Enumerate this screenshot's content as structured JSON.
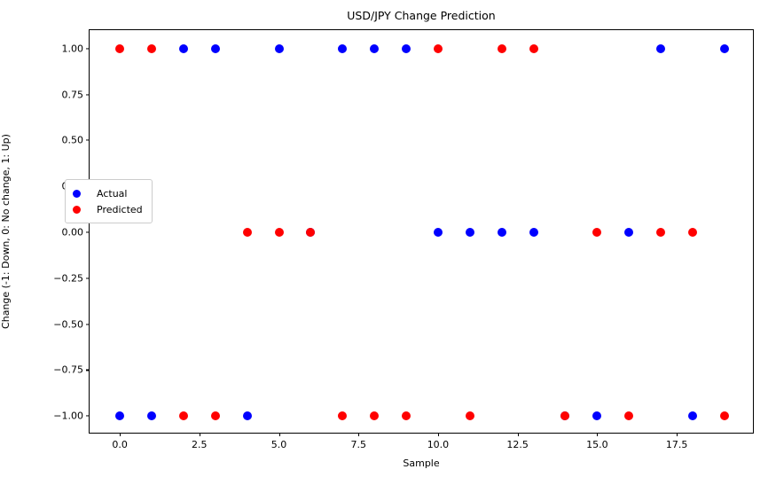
{
  "chart_data": {
    "type": "scatter",
    "title": "USD/JPY Change Prediction",
    "xlabel": "Sample",
    "ylabel": "Change (-1: Down, 0: No change, 1: Up)",
    "xlim": [
      -0.95,
      19.95
    ],
    "ylim": [
      -1.1,
      1.1
    ],
    "grid": false,
    "legend_position": "center left",
    "xticks": [
      "0.0",
      "2.5",
      "5.0",
      "7.5",
      "10.0",
      "12.5",
      "15.0",
      "17.5"
    ],
    "xtick_values": [
      0.0,
      2.5,
      5.0,
      7.5,
      10.0,
      12.5,
      15.0,
      17.5
    ],
    "yticks": [
      "-1.00",
      "-0.75",
      "-0.50",
      "-0.25",
      "0.00",
      "0.25",
      "0.50",
      "0.75",
      "1.00"
    ],
    "ytick_values": [
      -1.0,
      -0.75,
      -0.5,
      -0.25,
      0.0,
      0.25,
      0.5,
      0.75,
      1.0
    ],
    "x": [
      0,
      1,
      2,
      3,
      4,
      5,
      6,
      7,
      8,
      9,
      10,
      11,
      12,
      13,
      14,
      15,
      16,
      17,
      18,
      19
    ],
    "series": [
      {
        "name": "Actual",
        "color": "#0000ff",
        "marker": "circle",
        "values": [
          -1,
          -1,
          1,
          1,
          -1,
          1,
          0,
          1,
          1,
          1,
          0,
          0,
          0,
          0,
          -1,
          -1,
          0,
          1,
          -1,
          1
        ]
      },
      {
        "name": "Predicted",
        "color": "#ff0000",
        "marker": "circle",
        "values": [
          1,
          1,
          -1,
          -1,
          0,
          0,
          0,
          -1,
          -1,
          -1,
          1,
          -1,
          1,
          1,
          -1,
          0,
          -1,
          0,
          0,
          -1
        ]
      }
    ]
  },
  "legend": {
    "entries": [
      {
        "label": "Actual",
        "swatch": "blue-circle-marker"
      },
      {
        "label": "Predicted",
        "swatch": "red-circle-marker"
      }
    ]
  }
}
